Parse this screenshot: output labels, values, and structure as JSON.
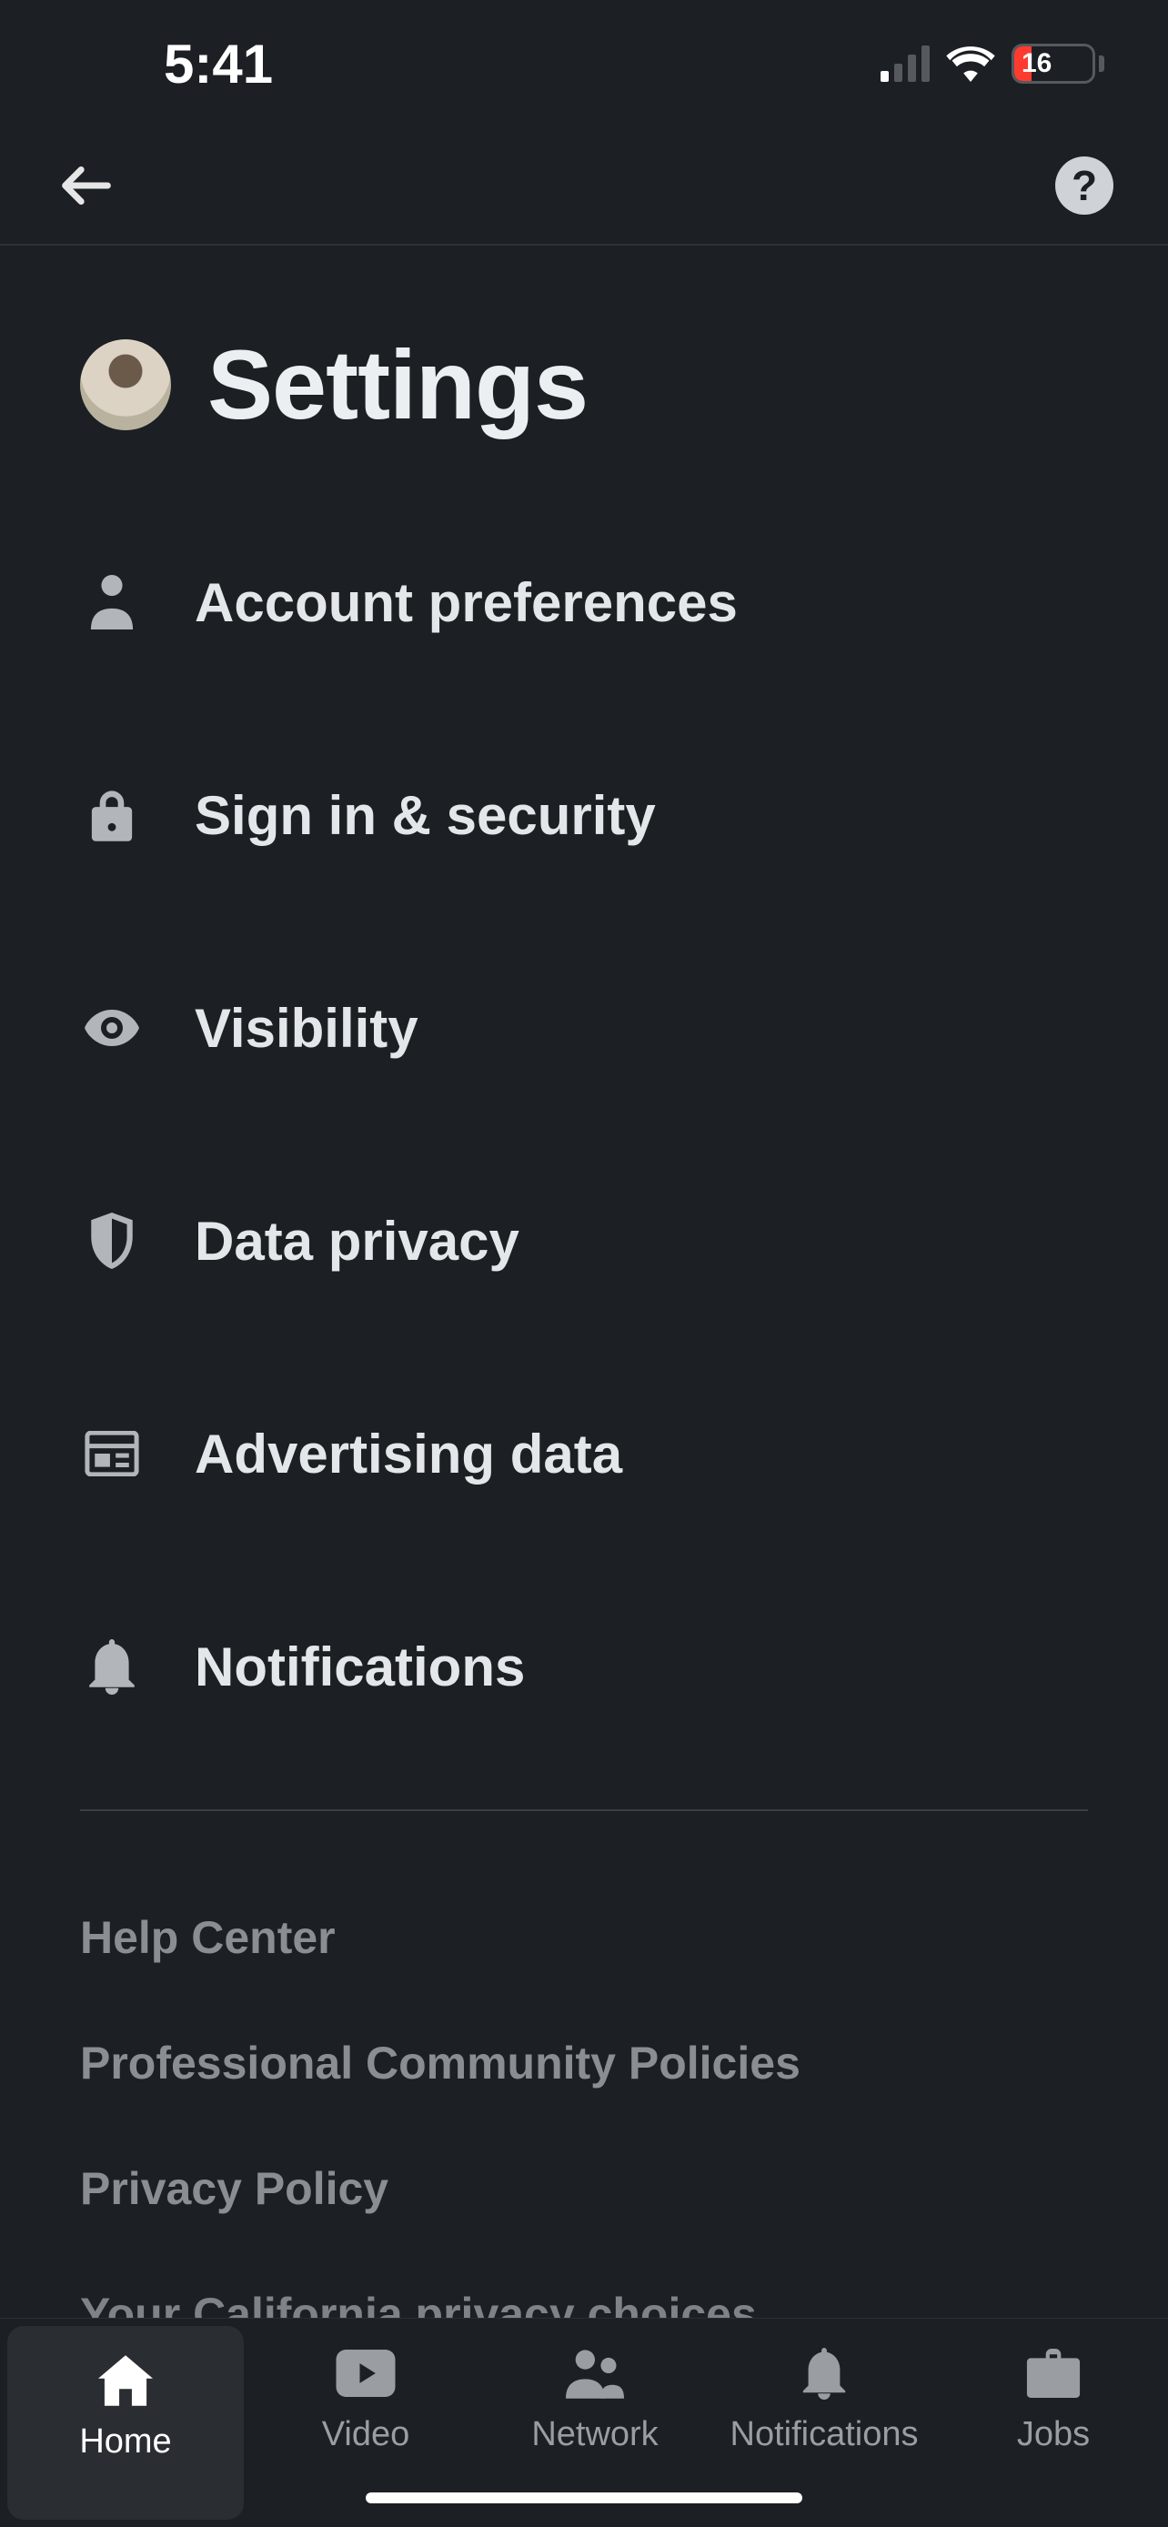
{
  "status_bar": {
    "time": "5:41",
    "battery_percent": "16"
  },
  "nav": {
    "help_label": "?"
  },
  "header": {
    "title": "Settings"
  },
  "settings_items": [
    {
      "icon": "person-icon",
      "label": "Account preferences"
    },
    {
      "icon": "lock-icon",
      "label": "Sign in & security"
    },
    {
      "icon": "eye-icon",
      "label": "Visibility"
    },
    {
      "icon": "shield-icon",
      "label": "Data privacy"
    },
    {
      "icon": "news-icon",
      "label": "Advertising data"
    },
    {
      "icon": "bell-icon",
      "label": "Notifications"
    }
  ],
  "secondary_links": [
    "Help Center",
    "Professional Community Policies",
    "Privacy Policy",
    "Your California privacy choices"
  ],
  "tabs": [
    {
      "icon": "home-icon",
      "label": "Home",
      "active": true
    },
    {
      "icon": "video-icon",
      "label": "Video",
      "active": false
    },
    {
      "icon": "network-icon",
      "label": "Network",
      "active": false
    },
    {
      "icon": "bell-icon",
      "label": "Notifications",
      "active": false
    },
    {
      "icon": "jobs-icon",
      "label": "Jobs",
      "active": false
    }
  ]
}
